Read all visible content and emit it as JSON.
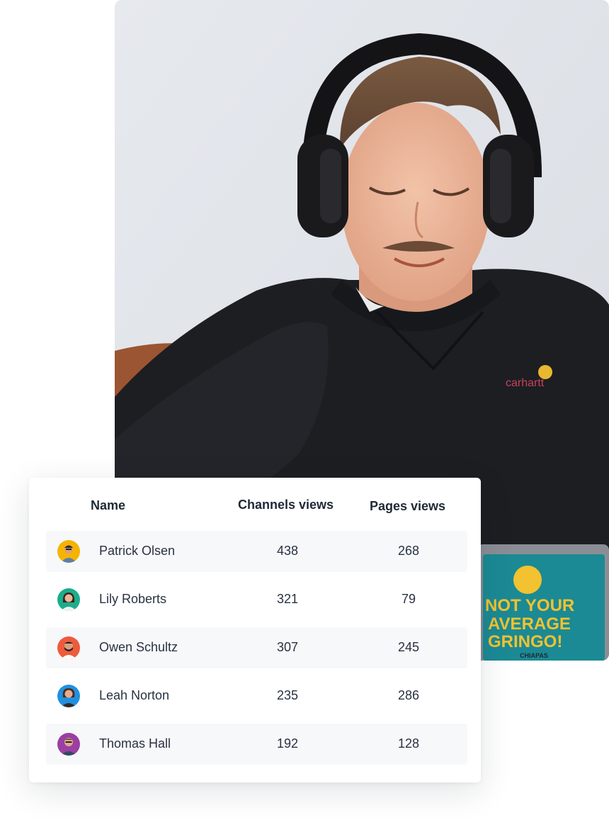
{
  "photo": {
    "subject": "man-with-headphones-photo",
    "sweater_brand": "carhartt",
    "sticker_line1": "NOT YOUR",
    "sticker_line2": "AVERAGE",
    "sticker_line3": "GRINGO!",
    "sticker_brand": "CHIAPAS"
  },
  "table": {
    "headers": {
      "name": "Name",
      "channels": "Channels views",
      "pages": "Pages views"
    },
    "rows": [
      {
        "name": "Patrick Olsen",
        "channels": "438",
        "pages": "268",
        "avatar_color": "#f4b400"
      },
      {
        "name": "Lily Roberts",
        "channels": "321",
        "pages": "79",
        "avatar_color": "#1aae8c"
      },
      {
        "name": "Owen Schultz",
        "channels": "307",
        "pages": "245",
        "avatar_color": "#ee5a3c"
      },
      {
        "name": "Leah Norton",
        "channels": "235",
        "pages": "286",
        "avatar_color": "#2190e0"
      },
      {
        "name": "Thomas Hall",
        "channels": "192",
        "pages": "128",
        "avatar_color": "#9b3fa3"
      }
    ]
  }
}
